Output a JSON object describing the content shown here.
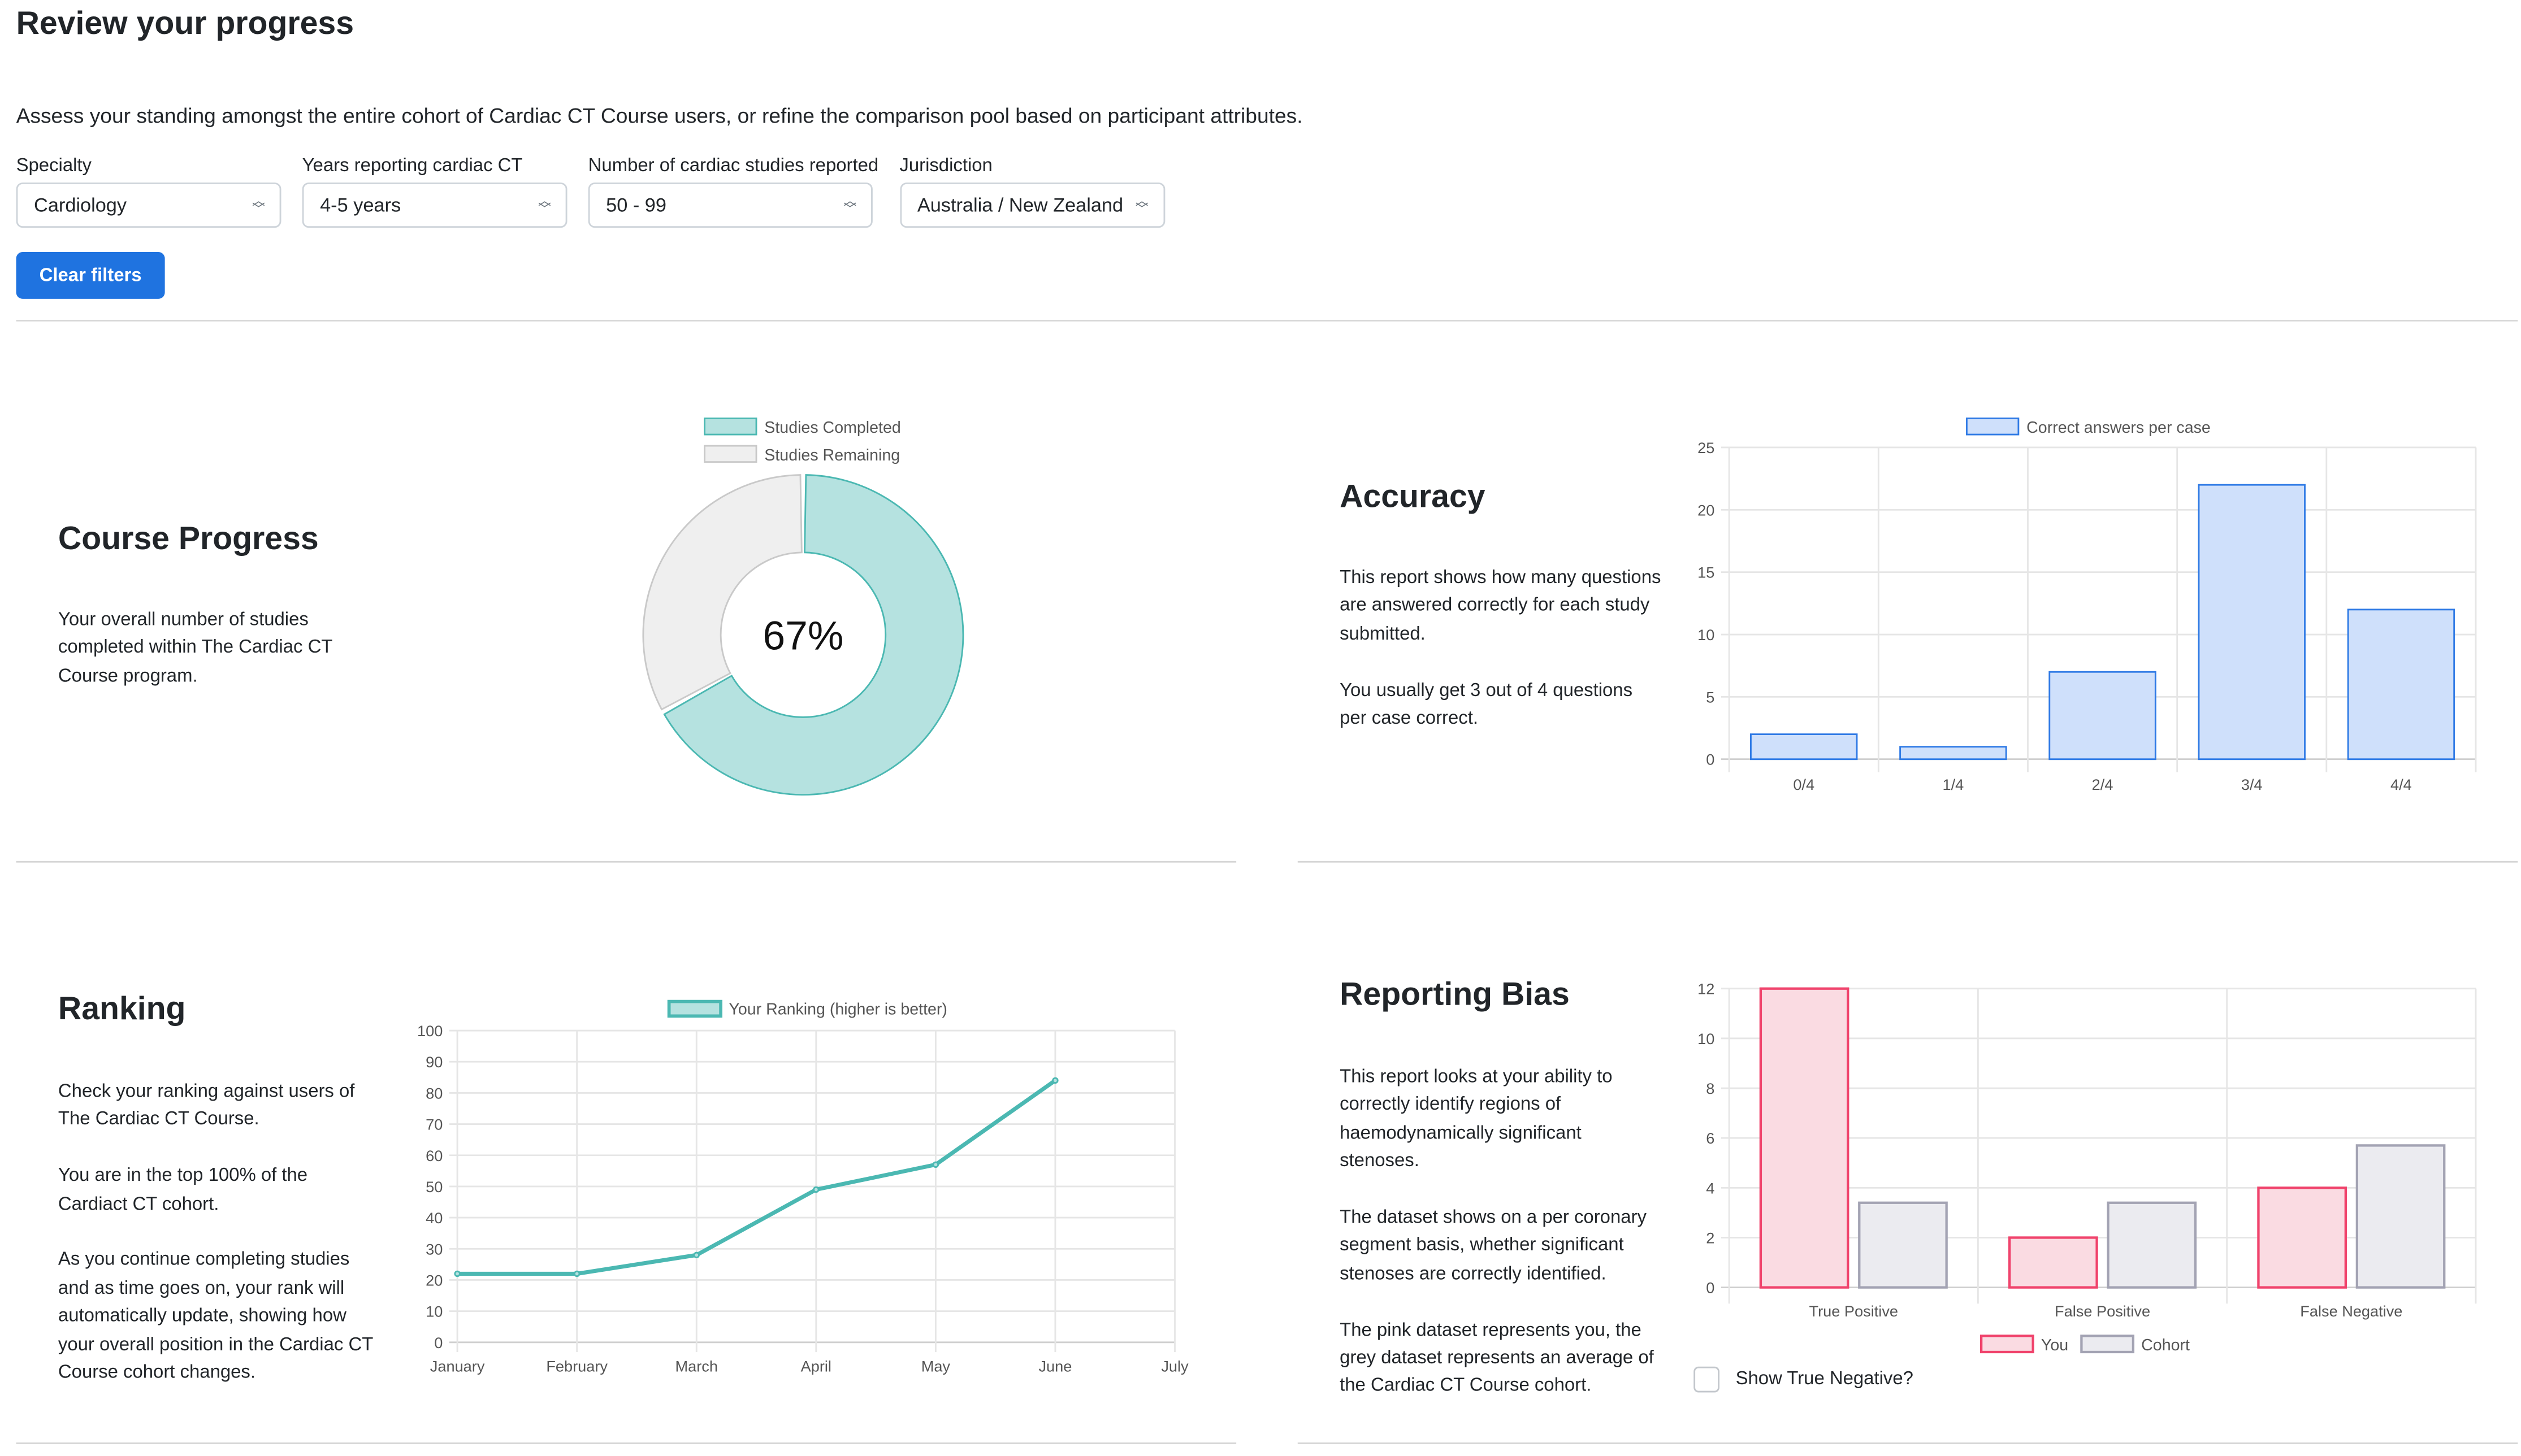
{
  "header": {
    "title": "Review your progress",
    "intro": "Assess your standing amongst the entire cohort of Cardiac CT Course users, or refine the comparison pool based on participant attributes."
  },
  "filters": [
    {
      "label": "Specialty",
      "value": "Cardiology"
    },
    {
      "label": "Years reporting cardiac CT",
      "value": "4-5 years"
    },
    {
      "label": "Number of cardiac studies reported",
      "value": "50 - 99"
    },
    {
      "label": "Jurisdiction",
      "value": "Australia / New Zealand"
    }
  ],
  "clear_filters_label": "Clear filters",
  "sections": {
    "course_progress": {
      "title": "Course Progress",
      "paragraphs": [
        "Your overall number of studies completed within The Cardiac CT Course program."
      ]
    },
    "accuracy": {
      "title": "Accuracy",
      "paragraphs": [
        "This report shows how many questions are answered correctly for each study submitted.",
        "You usually get 3 out of 4 questions per case correct."
      ]
    },
    "ranking": {
      "title": "Ranking",
      "paragraphs": [
        "Check your ranking against users of The Cardiac CT Course.",
        "You are in the top 100% of the Cardiact CT cohort.",
        "As you continue completing studies and as time goes on, your rank will automatically update, showing how your overall position in the Cardiac CT Course cohort changes."
      ]
    },
    "reporting_bias": {
      "title": "Reporting Bias",
      "paragraphs": [
        "This report looks at your ability to correctly identify regions of haemodynamically significant stenoses.",
        "The dataset shows on a per coronary segment basis, whether significant stenoses are correctly identified.",
        "The pink dataset represents you, the grey dataset represents an average of the Cardiac CT Course cohort."
      ],
      "checkbox_label": "Show True Negative?",
      "checkbox_checked": false
    }
  },
  "colors": {
    "accent": "#1f73e0",
    "teal": "#4bb8b2",
    "teal_fill": "#b5e2e0",
    "grey_fill": "#efefef",
    "grey_border": "#c9c9c9",
    "blue_fill": "#cfe0fb",
    "blue_border": "#2f7ae5",
    "pink_fill": "#fadbe2",
    "pink_border": "#f0436c",
    "cohort_fill": "#ebebf0",
    "cohort_border": "#a3a3b3"
  },
  "chart_data": [
    {
      "id": "course_progress",
      "type": "pie",
      "variant": "doughnut",
      "categories": [
        "Studies Completed",
        "Studies Remaining"
      ],
      "values": [
        67,
        33
      ],
      "center_label": "67%",
      "legend": "top"
    },
    {
      "id": "accuracy",
      "type": "bar",
      "categories": [
        "0/4",
        "1/4",
        "2/4",
        "3/4",
        "4/4"
      ],
      "series": [
        {
          "name": "Correct answers per case",
          "values": [
            2,
            1,
            7,
            22,
            12
          ]
        }
      ],
      "ylim": [
        0,
        25
      ],
      "yticks": [
        0,
        5,
        10,
        15,
        20,
        25
      ],
      "grid": true,
      "legend": "top"
    },
    {
      "id": "ranking",
      "type": "line",
      "categories": [
        "January",
        "February",
        "March",
        "April",
        "May",
        "June",
        "July"
      ],
      "series": [
        {
          "name": "Your Ranking (higher is better)",
          "values": [
            22,
            22,
            28,
            49,
            57,
            84,
            null
          ]
        }
      ],
      "ylim": [
        0,
        100
      ],
      "yticks": [
        0,
        10,
        20,
        30,
        40,
        50,
        60,
        70,
        80,
        90,
        100
      ],
      "grid": true,
      "legend": "top"
    },
    {
      "id": "reporting_bias",
      "type": "bar",
      "categories": [
        "True Positive",
        "False Positive",
        "False Negative"
      ],
      "series": [
        {
          "name": "You",
          "values": [
            12,
            2,
            4
          ]
        },
        {
          "name": "Cohort",
          "values": [
            3.4,
            3.4,
            5.7
          ]
        }
      ],
      "ylim": [
        0,
        12
      ],
      "yticks": [
        0,
        2,
        4,
        6,
        8,
        10,
        12
      ],
      "grid": true,
      "legend": "bottom"
    }
  ]
}
